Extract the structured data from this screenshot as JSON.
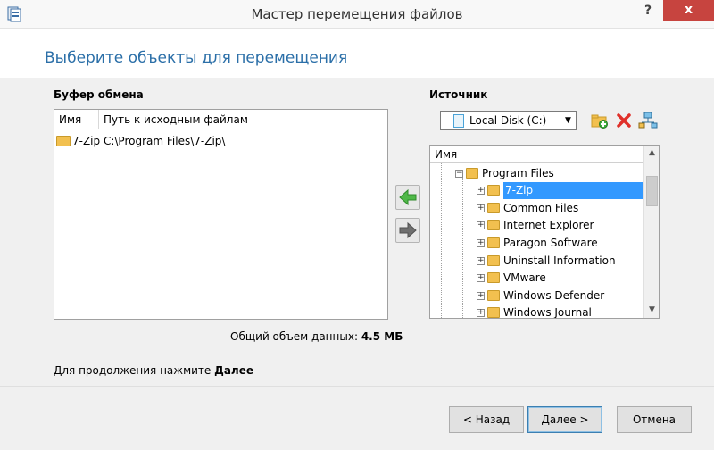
{
  "window": {
    "title": "Мастер перемещения файлов",
    "help": "?",
    "close": "x"
  },
  "heading": "Выберите объекты для перемещения",
  "clipboard": {
    "label": "Буфер обмена",
    "columns": [
      "Имя",
      "Путь к исходным файлам"
    ],
    "rows": [
      {
        "name": "7-Zip",
        "path": "C:\\Program Files\\7-Zip\\"
      }
    ]
  },
  "total": {
    "label": "Общий объем данных:",
    "value": "4.5 МБ"
  },
  "source": {
    "label": "Источник",
    "drive": "Local Disk (C:)",
    "tree_header": "Имя",
    "tree": [
      {
        "label": "Program Files",
        "level": 0,
        "expander": "-"
      },
      {
        "label": "7-Zip",
        "level": 1,
        "expander": "+",
        "selected": true
      },
      {
        "label": "Common Files",
        "level": 1,
        "expander": "+"
      },
      {
        "label": "Internet Explorer",
        "level": 1,
        "expander": "+"
      },
      {
        "label": "Paragon Software",
        "level": 1,
        "expander": "+"
      },
      {
        "label": "Uninstall Information",
        "level": 1,
        "expander": "+"
      },
      {
        "label": "VMware",
        "level": 1,
        "expander": "+"
      },
      {
        "label": "Windows Defender",
        "level": 1,
        "expander": "+"
      },
      {
        "label": "Windows Journal",
        "level": 1,
        "expander": "+"
      }
    ]
  },
  "continue_hint": {
    "text": "Для продолжения нажмите",
    "bold": "Далее"
  },
  "buttons": {
    "back": "< Назад",
    "next": "Далее >",
    "cancel": "Отмена"
  },
  "colors": {
    "heading": "#2b6fa8",
    "selection": "#3399ff",
    "close": "#c7443f"
  }
}
